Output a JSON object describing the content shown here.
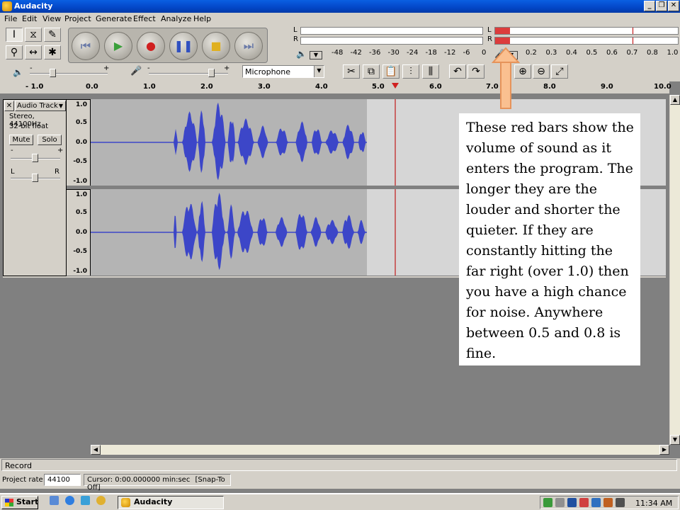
{
  "window": {
    "title": "Audacity"
  },
  "menu": [
    "File",
    "Edit",
    "View",
    "Project",
    "Generate",
    "Effect",
    "Analyze",
    "Help"
  ],
  "meter": {
    "channel_left": "L",
    "channel_right": "R",
    "input_ticks": [
      "-48",
      "-42",
      "-36",
      "-30",
      "-24",
      "-18",
      "-12",
      "-6",
      "0"
    ],
    "output_ticks": [
      "0.2",
      "0.3",
      "0.4",
      "0.5",
      "0.6",
      "0.7",
      "0.8",
      "1.0"
    ],
    "left_level": 0.08,
    "right_level": 0.08,
    "meter_color": "#dc3c3c"
  },
  "mixer": {
    "input_source": "Microphone"
  },
  "ruler": {
    "labels": [
      "- 1.0",
      "0.0",
      "1.0",
      "2.0",
      "3.0",
      "4.0",
      "5.0",
      "6.0",
      "7.0",
      "8.0",
      "9.0",
      "10.0"
    ]
  },
  "track": {
    "name": "Audio Track",
    "format_line1": "Stereo, 44100Hz",
    "format_line2": "32-bit float",
    "mute_label": "Mute",
    "solo_label": "Solo",
    "gain_minus": "-",
    "gain_plus": "+",
    "pan_left": "L",
    "pan_right": "R",
    "close_label": "✕",
    "scale_top": [
      "1.0",
      "0.5",
      "0.0",
      "-0.5",
      "-1.0"
    ],
    "scale_bottom": [
      "1.0",
      "0.5",
      "0.0",
      "-0.5",
      "-1.0"
    ],
    "wave_color": "#3c46c8"
  },
  "status": {
    "mode": "Record",
    "project_rate_label": "Project rate:",
    "project_rate_value": "44100",
    "cursor": "Cursor: 0:00.000000 min:sec",
    "snap": "[Snap-To Off]"
  },
  "taskbar": {
    "start_label": "Start",
    "task_label": "Audacity",
    "clock": "11:34 AM"
  },
  "callout": {
    "text": "These red bars show the volume of sound as it enters the program. The longer they are the louder and shorter the quieter.  If they are constantly hitting the far right (over 1.0) then you have a high chance for noise.  Anywhere between 0.5 and 0.8 is fine."
  }
}
